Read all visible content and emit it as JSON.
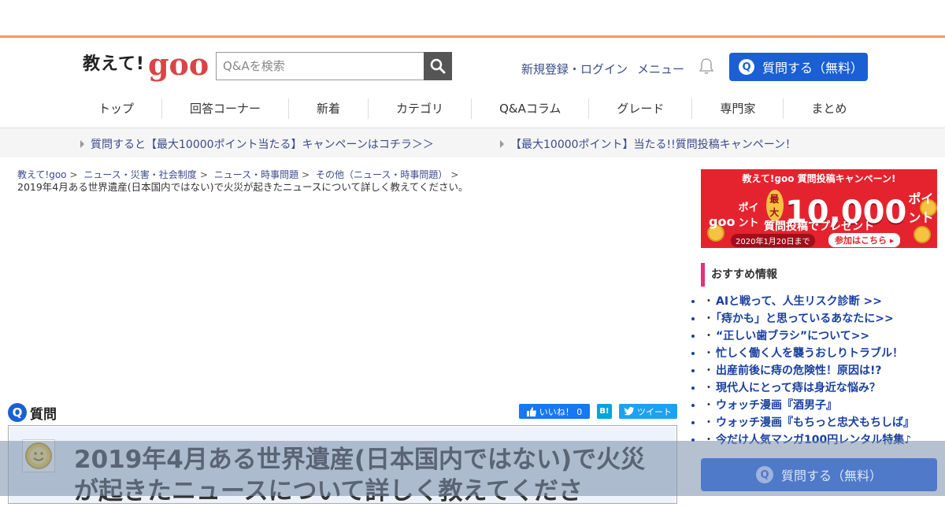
{
  "header": {
    "logo_text": "教えて!",
    "logo_brand": "goo",
    "search_placeholder": "Q&Aを検索",
    "register_login": "新規登録・ログイン",
    "menu": "メニュー",
    "ask_button": "質問する（無料）"
  },
  "nav": {
    "items": [
      "トップ",
      "回答コーナー",
      "新着",
      "カテゴリ",
      "Q&Aコラム",
      "グレード",
      "専門家",
      "まとめ"
    ]
  },
  "notices": [
    "質問すると【最大10000ポイント当たる】キャンペーンはコチラ＞＞",
    "【最大10000ポイント】当たる!!質問投稿キャンペーン！"
  ],
  "breadcrumb": {
    "items": [
      "教えて!goo",
      "ニュース・災害・社会制度",
      "ニュース・時事問題",
      "その他（ニュース・時事問題）"
    ],
    "separator": ">",
    "current": "2019年4月ある世界遺産(日本国内ではない)で火災が起きたニュースについて詳しく教えてください。"
  },
  "question": {
    "label": "質問",
    "badge": "Q",
    "title": "2019年4月ある世界遺産(日本国内ではない)で火災が起きたニュースについて詳しく教えてくださ",
    "share_like": "いいね！ 0",
    "share_hatena": "B!",
    "share_tweet": "ツイート"
  },
  "banner": {
    "top": "教えて!goo 質問投稿キャンペーン!",
    "goo": "goo",
    "points_label": "ポイント",
    "max": "最大",
    "amount": "10,000",
    "points_suffix": "ポイント",
    "sub": "質問投稿でプレゼント",
    "date": "2020年1月20日まで",
    "join": "参加はこちら ▸"
  },
  "recommend": {
    "title": "おすすめ情報",
    "items": [
      "AIと戦って、人生リスク診断 >>",
      "「痔かも」と思っているあなたに>>",
      "“正しい歯ブラシ”について>>",
      "忙しく働く人を襲うおしりトラブル！",
      "出産前後に痔の危険性！原因は!?",
      "現代人にとって痔は身近な悩み？",
      "ウォッチ漫画『酒男子』",
      "ウォッチ漫画『もちっと忠犬もちしば』",
      "今だけ人気マンガ100円レンタル特集♪"
    ]
  },
  "floating": {
    "ask_button": "質問する（無料）"
  },
  "colors": {
    "accent_orange": "#f39b5f",
    "primary_blue": "#1a5fd4",
    "link_blue": "#3a4c8a",
    "brand_red": "#d94545"
  }
}
